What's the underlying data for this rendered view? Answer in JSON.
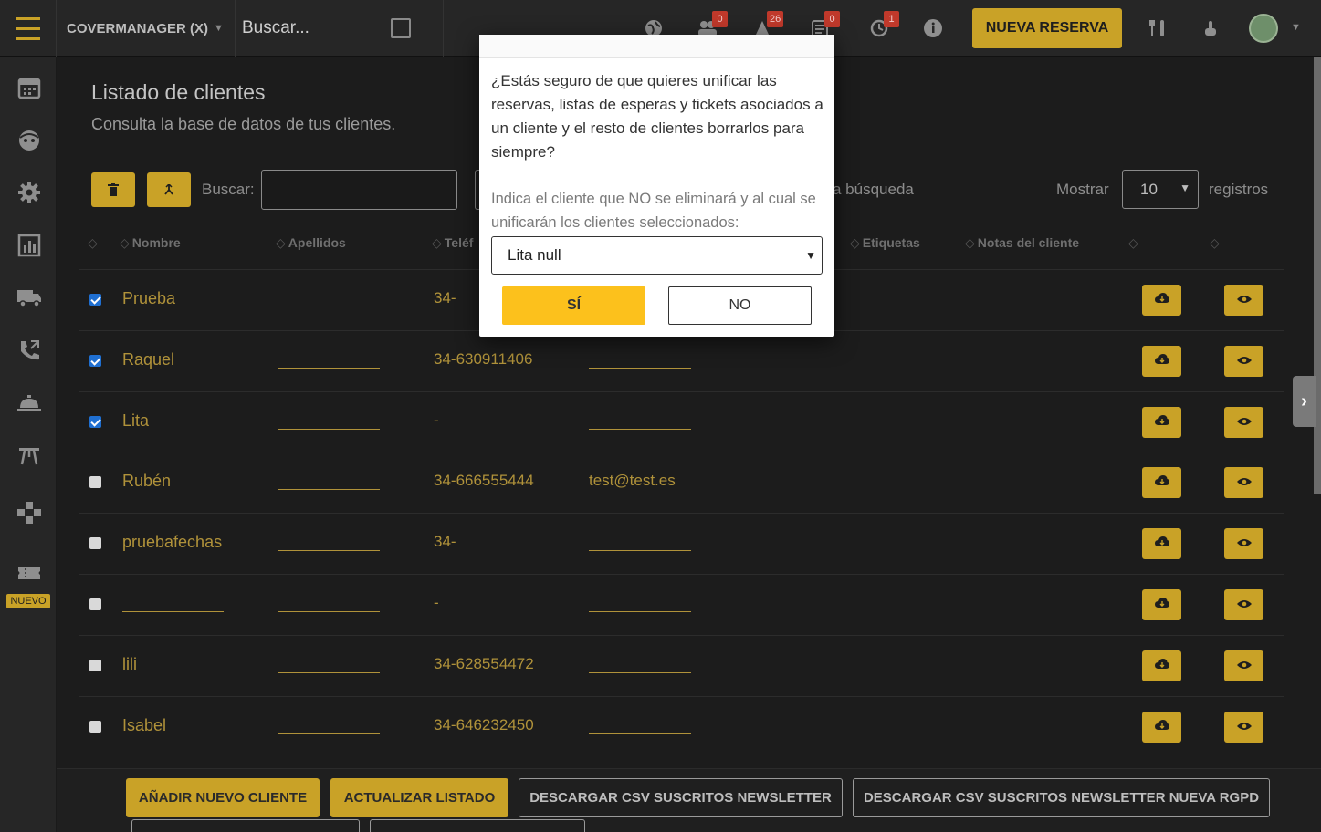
{
  "topbar": {
    "restaurant": "COVERMANAGER (X)",
    "search_placeholder": "Buscar...",
    "badges": [
      "0",
      "26",
      "0",
      "1"
    ],
    "new_reservation": "NUEVA RESERVA"
  },
  "sidebar": {
    "nuevo": "NUEVO",
    "icons": [
      "calendar-icon",
      "face-icon",
      "settings-icon",
      "stats-icon",
      "truck-icon",
      "phone-icon",
      "cloche-icon",
      "table-icon",
      "gamepad-icon",
      "ticket-icon"
    ]
  },
  "page": {
    "title": "Listado de clientes",
    "subtitle": "Consulta la base de datos de tus clientes.",
    "search_label": "Buscar:",
    "busqueda_label": "a búsqueda",
    "mostrar_label": "Mostrar",
    "mostrar_value": "10",
    "registros_label": "registros"
  },
  "table": {
    "headers": [
      "Nombre",
      "Apellidos",
      "Teléf",
      "Etiquetas",
      "Notas del cliente"
    ],
    "rows": [
      {
        "name": "Prueba",
        "phone": "34-",
        "email": "",
        "checked": true
      },
      {
        "name": "Raquel",
        "phone": "34-630911406",
        "email": "",
        "checked": true
      },
      {
        "name": "Lita",
        "phone": "-",
        "email": "",
        "checked": true
      },
      {
        "name": "Rubén",
        "phone": "34-666555444",
        "email": "test@test.es",
        "checked": false
      },
      {
        "name": "pruebafechas",
        "phone": "34-",
        "email": "",
        "checked": false
      },
      {
        "name": "",
        "phone": "-",
        "email": "",
        "checked": false
      },
      {
        "name": "lili",
        "phone": "34-628554472",
        "email": "",
        "checked": false
      },
      {
        "name": "Isabel",
        "phone": "34-646232450",
        "email": "",
        "checked": false
      }
    ]
  },
  "bottom": {
    "add_client": "AÑADIR NUEVO CLIENTE",
    "refresh": "ACTUALIZAR LISTADO",
    "csv_newsletter": "DESCARGAR CSV SUSCRITOS NEWSLETTER",
    "csv_rgpd": "DESCARGAR CSV SUSCRITOS NEWSLETTER NUEVA RGPD"
  },
  "modal": {
    "question": "¿Estás seguro de que quieres unificar las reservas, listas de esperas y tickets asociados a un cliente y el resto de clientes borrarlos para siempre?",
    "hint": "Indica el cliente que NO se eliminará y al cual se unificarán los clientes seleccionados:",
    "selected_client": "Lita null",
    "yes": "SÍ",
    "no": "NO"
  },
  "colors": {
    "accent": "#c9a227",
    "modal_yes": "#fcc11c",
    "badge": "#c0392b"
  }
}
